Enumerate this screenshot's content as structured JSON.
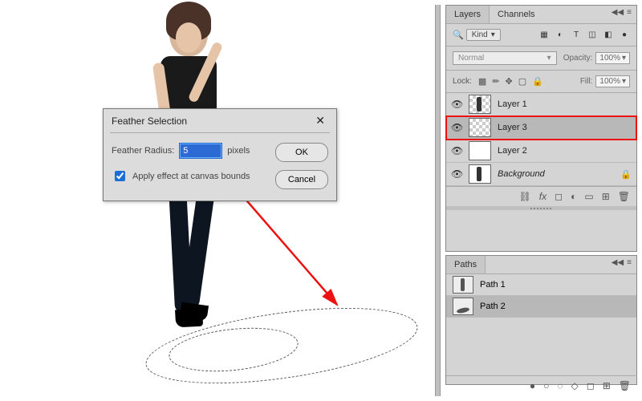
{
  "dialog": {
    "title": "Feather Selection",
    "radius_label": "Feather Radius:",
    "radius_value": "5",
    "radius_unit": "pixels",
    "apply_bounds_label": "Apply effect at canvas bounds",
    "apply_bounds_checked": true,
    "ok": "OK",
    "cancel": "Cancel"
  },
  "layers_panel": {
    "tabs": [
      "Layers",
      "Channels"
    ],
    "active_tab": 0,
    "search_icon_label": "🔍",
    "kind_label": "Kind",
    "filter_icons": [
      "image",
      "adjust",
      "text",
      "shape",
      "smart",
      "artboard"
    ],
    "blend_mode": "Normal",
    "opacity_label": "Opacity:",
    "opacity_value": "100%",
    "lock_label": "Lock:",
    "fill_label": "Fill:",
    "fill_value": "100%",
    "layers": [
      {
        "visible": true,
        "name": "Layer 1",
        "thumb": "person_chk",
        "selected": false,
        "highlight": false
      },
      {
        "visible": true,
        "name": "Layer 3",
        "thumb": "chk",
        "selected": true,
        "highlight": true
      },
      {
        "visible": true,
        "name": "Layer 2",
        "thumb": "white",
        "selected": false,
        "highlight": false
      },
      {
        "visible": true,
        "name": "Background",
        "thumb": "person_white",
        "selected": false,
        "italic": true,
        "locked": true
      }
    ],
    "footer_icons": [
      "link",
      "fx",
      "mask",
      "adj",
      "group",
      "new",
      "trash"
    ]
  },
  "paths_panel": {
    "tab": "Paths",
    "paths": [
      {
        "name": "Path 1",
        "thumb": "sil",
        "selected": false
      },
      {
        "name": "Path 2",
        "thumb": "shadow",
        "selected": true
      }
    ],
    "footer_icons": [
      "fill",
      "stroke",
      "sel",
      "mask",
      "new",
      "trash"
    ]
  }
}
